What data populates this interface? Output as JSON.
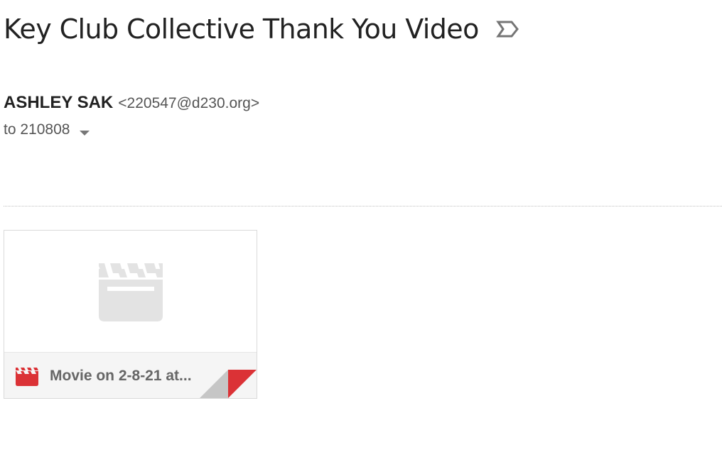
{
  "email": {
    "subject": "Key Club Collective Thank You Video",
    "sender": {
      "name": "ASHLEY SAK",
      "email": "<220547@d230.org>"
    },
    "recipient_label": "to 210808"
  },
  "attachment": {
    "filename": "Movie on 2-8-21 at...",
    "type_icon": "video-clapperboard-icon"
  },
  "colors": {
    "attachment_icon_red": "#db3236",
    "preview_icon_gray": "#e3e3e3",
    "fold_gray": "#c6c6c6"
  }
}
